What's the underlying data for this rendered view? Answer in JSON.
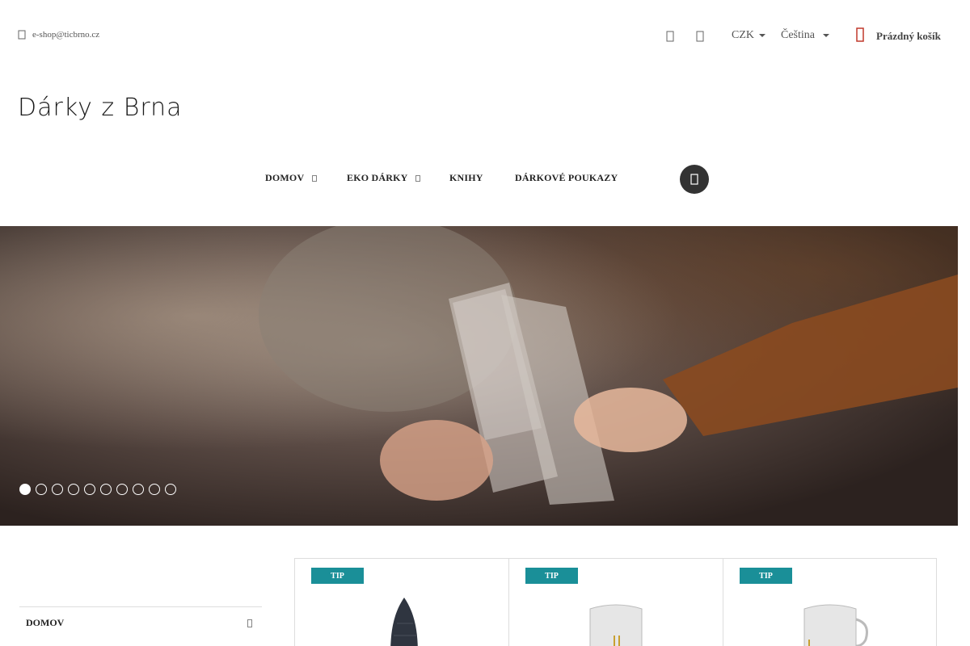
{
  "topbar": {
    "email": "e-shop@ticbrno.cz",
    "currency": "CZK",
    "language": "Čeština",
    "cart_label": "Prázdný košík",
    "icons": [
      "envelope-icon",
      "user-icon",
      "heart-icon",
      "cart-icon"
    ]
  },
  "logo": {
    "text": "Dárky z Brna"
  },
  "nav": {
    "items": [
      {
        "label": "DOMOV",
        "has_dropdown": true
      },
      {
        "label": "EKO DÁRKY",
        "has_dropdown": true
      },
      {
        "label": "KNIHY",
        "has_dropdown": false
      },
      {
        "label": "DÁRKOVÉ POUKAZY",
        "has_dropdown": false
      }
    ]
  },
  "slider": {
    "slide_count": 10,
    "active_index": 0
  },
  "sidebar": {
    "title": "DOMOV"
  },
  "products": [
    {
      "badge": "TIP"
    },
    {
      "badge": "TIP"
    },
    {
      "badge": "TIP"
    }
  ],
  "colors": {
    "accent": "#1a8f98",
    "cart_icon": "#c0392b",
    "search_button": "#333333"
  }
}
